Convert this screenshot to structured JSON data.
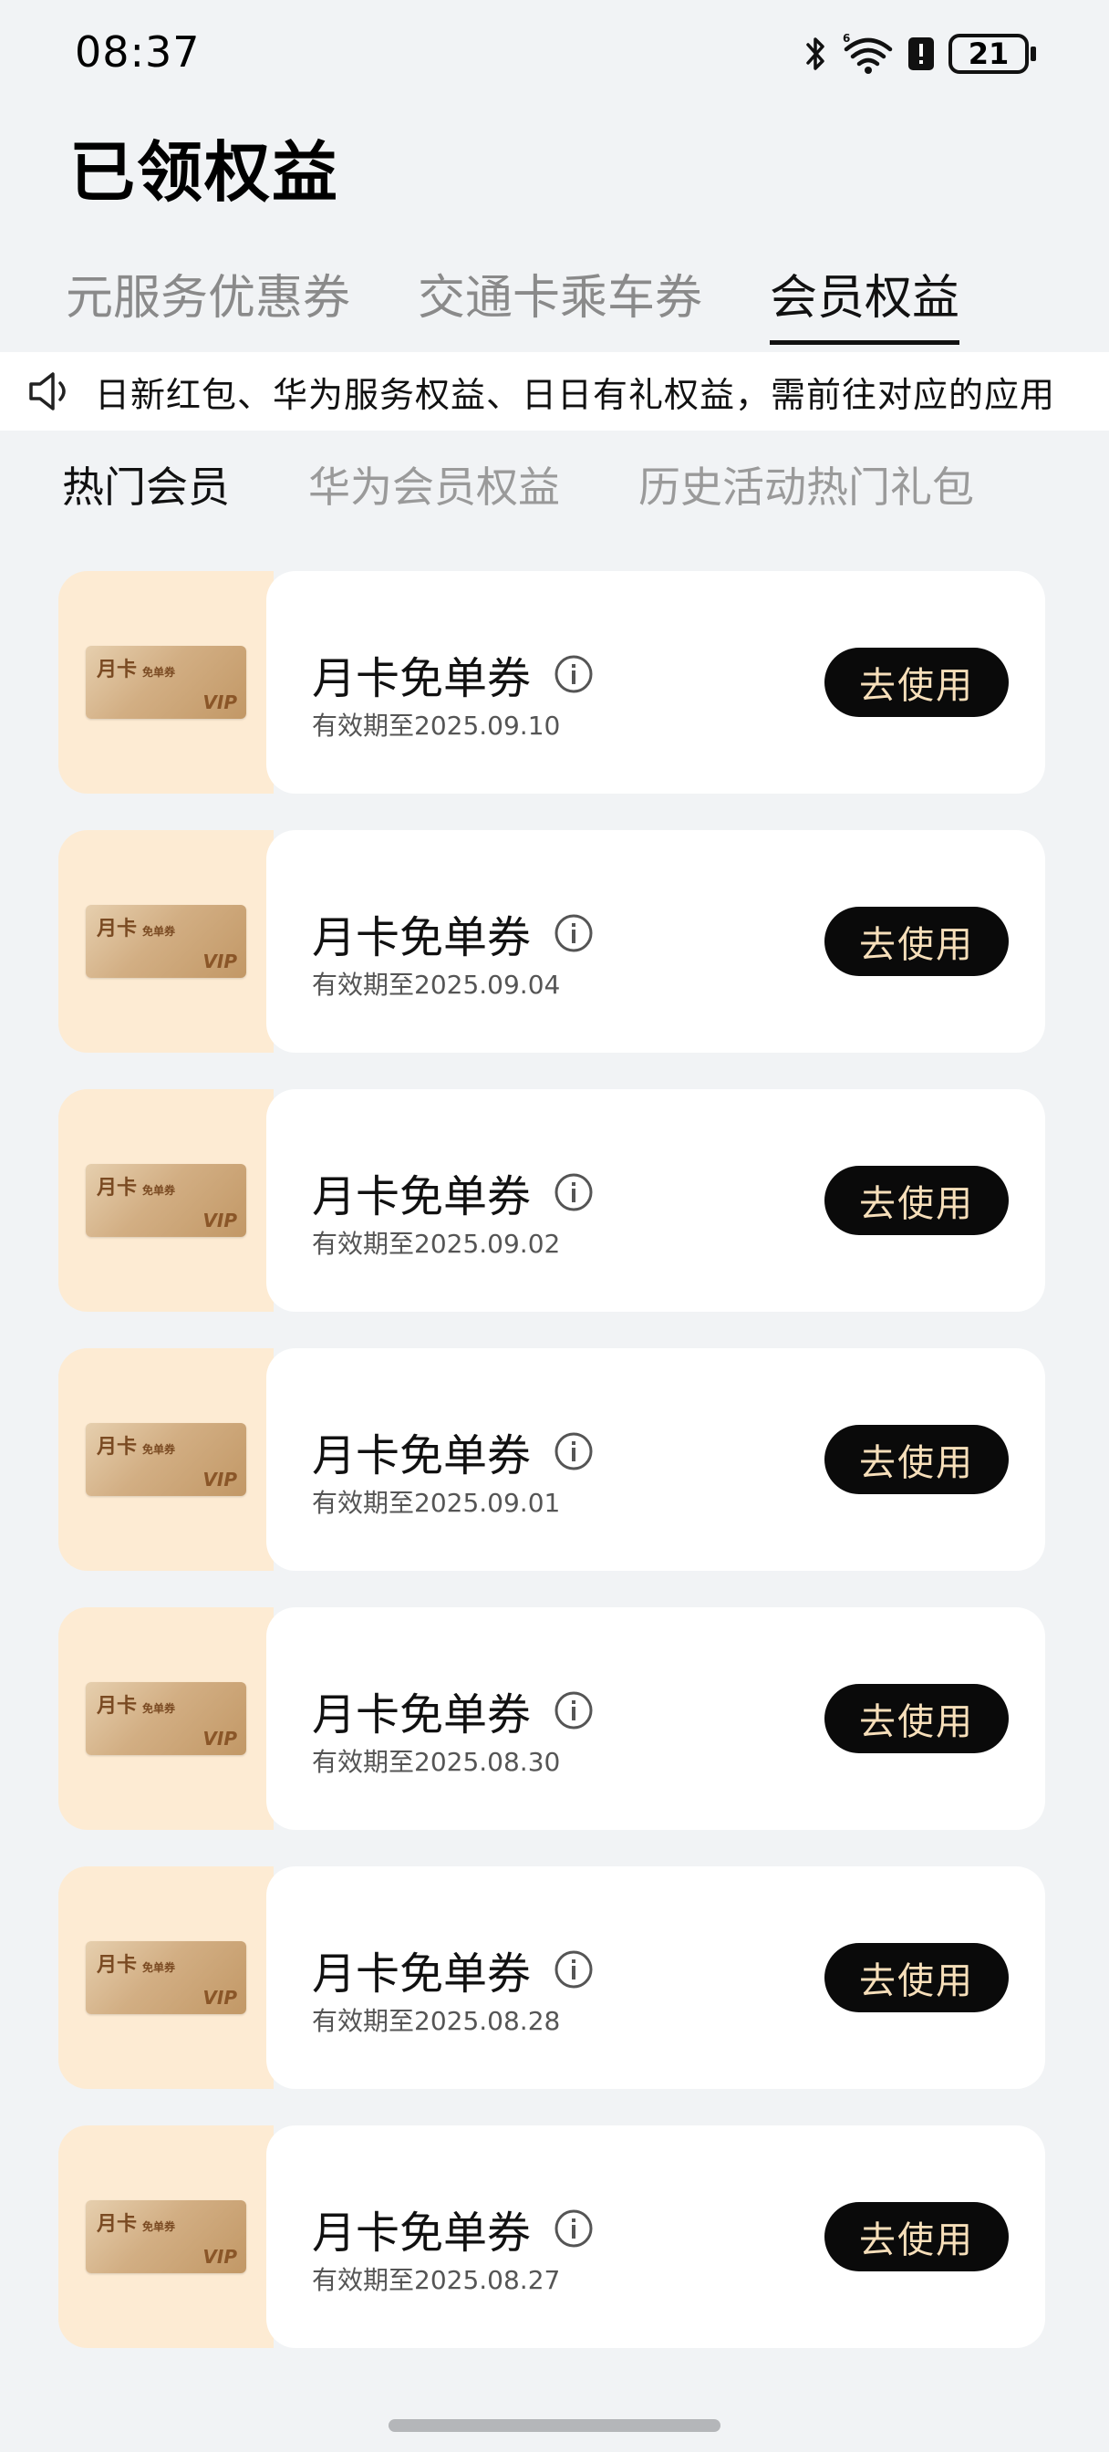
{
  "status_bar": {
    "time": "08:37",
    "battery": "21"
  },
  "title": "已领权益",
  "top_tabs": [
    "元服务优惠券",
    "交通卡乘车券",
    "会员权益"
  ],
  "notice": "日新红包、华为服务权益、日日有礼权益，需前往对应的应用",
  "sub_tabs": [
    "热门会员",
    "华为会员权益",
    "历史活动热门礼包"
  ],
  "card_art": {
    "title": "月卡",
    "subtitle": "免单券",
    "badge": "VIP"
  },
  "coupons": [
    {
      "name": "月卡免单券",
      "expiry": "有效期至2025.09.10",
      "button": "去使用"
    },
    {
      "name": "月卡免单券",
      "expiry": "有效期至2025.09.04",
      "button": "去使用"
    },
    {
      "name": "月卡免单券",
      "expiry": "有效期至2025.09.02",
      "button": "去使用"
    },
    {
      "name": "月卡免单券",
      "expiry": "有效期至2025.09.01",
      "button": "去使用"
    },
    {
      "name": "月卡免单券",
      "expiry": "有效期至2025.08.30",
      "button": "去使用"
    },
    {
      "name": "月卡免单券",
      "expiry": "有效期至2025.08.28",
      "button": "去使用"
    },
    {
      "name": "月卡免单券",
      "expiry": "有效期至2025.08.27",
      "button": "去使用"
    }
  ],
  "colors": {
    "background": "#f1f3f5",
    "thumb_bg": "#fdebd3",
    "button_bg": "#0a0a0a",
    "button_text": "#f7dfba"
  }
}
